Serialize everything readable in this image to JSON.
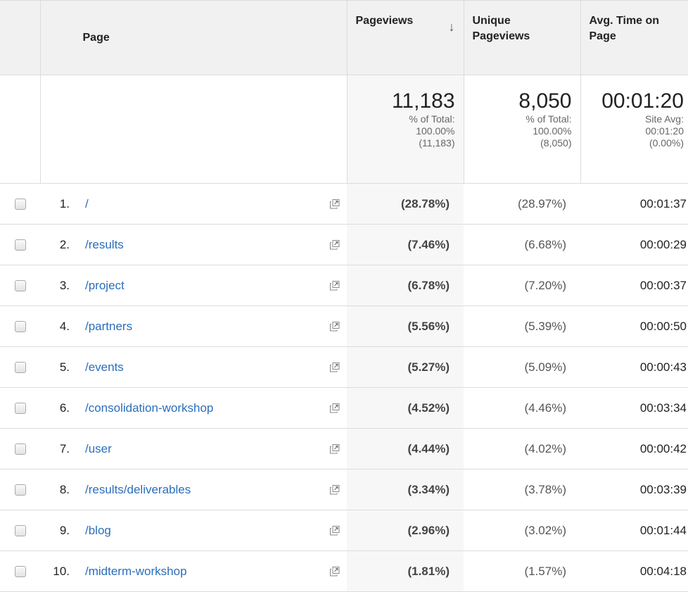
{
  "headers": {
    "page": "Page",
    "pageviews": "Pageviews",
    "unique_pageviews_line1": "Unique",
    "unique_pageviews_line2": "Pageviews",
    "avg_time_line1": "Avg. Time on",
    "avg_time_line2": "Page",
    "sort_icon": "sort-down-arrow-icon"
  },
  "summary": {
    "pageviews": {
      "value": "11,183",
      "l1": "% of Total:",
      "l2": "100.00%",
      "l3": "(11,183)"
    },
    "unique_pageviews": {
      "value": "8,050",
      "l1": "% of Total:",
      "l2": "100.00%",
      "l3": "(8,050)"
    },
    "avg_time": {
      "value": "00:01:20",
      "l1": "Site Avg:",
      "l2": "00:01:20",
      "l3": "(0.00%)"
    }
  },
  "rows": [
    {
      "num": "1.",
      "page": "/",
      "pv": "(28.78%)",
      "upv": "(28.97%)",
      "avg": "00:01:37"
    },
    {
      "num": "2.",
      "page": "/results",
      "pv": "(7.46%)",
      "upv": "(6.68%)",
      "avg": "00:00:29"
    },
    {
      "num": "3.",
      "page": "/project",
      "pv": "(6.78%)",
      "upv": "(7.20%)",
      "avg": "00:00:37"
    },
    {
      "num": "4.",
      "page": "/partners",
      "pv": "(5.56%)",
      "upv": "(5.39%)",
      "avg": "00:00:50"
    },
    {
      "num": "5.",
      "page": "/events",
      "pv": "(5.27%)",
      "upv": "(5.09%)",
      "avg": "00:00:43"
    },
    {
      "num": "6.",
      "page": "/consolidation-workshop",
      "pv": "(4.52%)",
      "upv": "(4.46%)",
      "avg": "00:03:34"
    },
    {
      "num": "7.",
      "page": "/user",
      "pv": "(4.44%)",
      "upv": "(4.02%)",
      "avg": "00:00:42"
    },
    {
      "num": "8.",
      "page": "/results/deliverables",
      "pv": "(3.34%)",
      "upv": "(3.78%)",
      "avg": "00:03:39"
    },
    {
      "num": "9.",
      "page": "/blog",
      "pv": "(2.96%)",
      "upv": "(3.02%)",
      "avg": "00:01:44"
    },
    {
      "num": "10.",
      "page": "/midterm-workshop",
      "pv": "(1.81%)",
      "upv": "(1.57%)",
      "avg": "00:04:18"
    }
  ],
  "colors": {
    "link": "#2a6ebb",
    "header_bg": "#f1f1f1",
    "sorted_col_bg": "#f7f7f7",
    "border": "#dcdcdc"
  }
}
